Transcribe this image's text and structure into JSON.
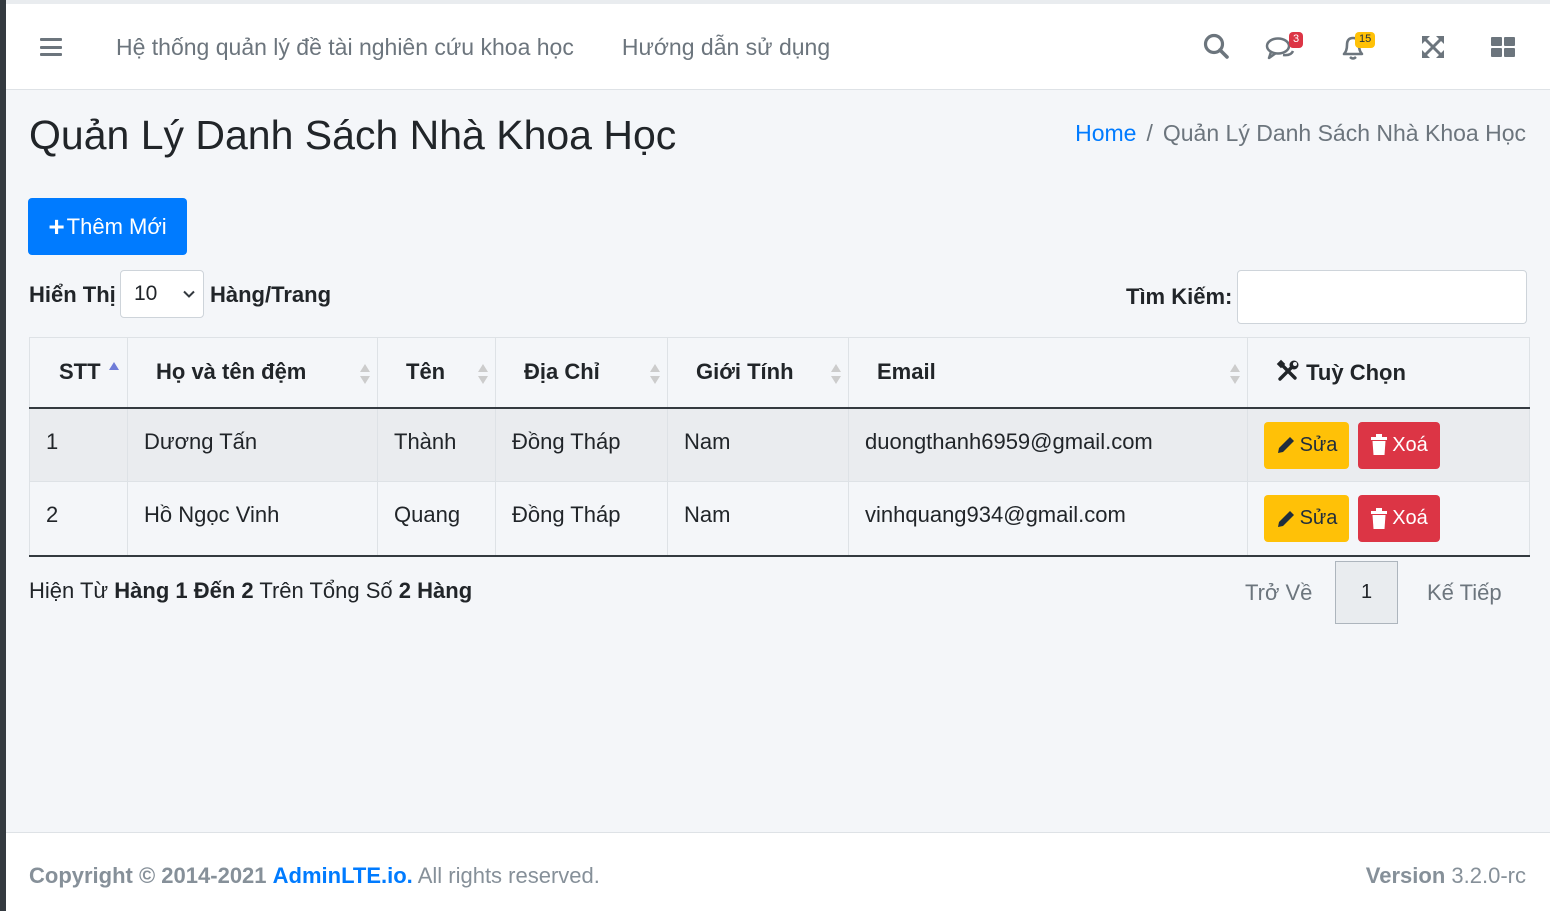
{
  "navbar": {
    "links": [
      "Hệ thống quản lý đề tài nghiên cứu khoa học",
      "Hướng dẫn sử dụng"
    ],
    "messages_count": "3",
    "notifications_count": "15",
    "icons": [
      "menu-icon",
      "search-icon",
      "comments-icon",
      "bell-icon",
      "fullscreen-icon",
      "grid-icon"
    ]
  },
  "page": {
    "title": "Quản Lý Danh Sách Nhà Khoa Học",
    "breadcrumb_home": "Home",
    "breadcrumb_separator": "/",
    "breadcrumb_current": "Quản Lý Danh Sách Nhà Khoa Học",
    "add_button": "Thêm Mới"
  },
  "controls": {
    "length_label": "Hiển Thị",
    "length_value": "10",
    "length_suffix": "Hàng/Trang",
    "search_label": "Tìm Kiếm:",
    "search_value": ""
  },
  "table": {
    "headers": [
      "STT",
      "Họ và tên đệm",
      "Tên",
      "Địa Chỉ",
      "Giới Tính",
      "Email",
      "Tuỳ Chọn"
    ],
    "rows": [
      [
        "1",
        "Dương Tấn",
        "Thành",
        "Đồng Tháp",
        "Nam",
        "duongthanh6959@gmail.com"
      ],
      [
        "2",
        "Hồ Ngọc Vinh",
        "Quang",
        "Đồng Tháp",
        "Nam",
        "vinhquang934@gmail.com"
      ]
    ],
    "edit_label": "Sửa",
    "delete_label": "Xoá"
  },
  "info": {
    "prefix": "Hiện Từ",
    "range": "Hàng 1 Đến 2",
    "middle": "Trên Tổng Số",
    "total": "2 Hàng"
  },
  "pagination": {
    "prev": "Trở Về",
    "current": "1",
    "next": "Kế Tiếp"
  },
  "footer": {
    "copyright": "Copyright © 2014-2021",
    "brand": "AdminLTE.io.",
    "rights": "All rights reserved.",
    "version_label": "Version",
    "version_value": "3.2.0-rc"
  },
  "colors": {
    "primary": "#007bff",
    "warning": "#ffc107",
    "danger": "#dc3545",
    "background": "#f4f6f9"
  }
}
